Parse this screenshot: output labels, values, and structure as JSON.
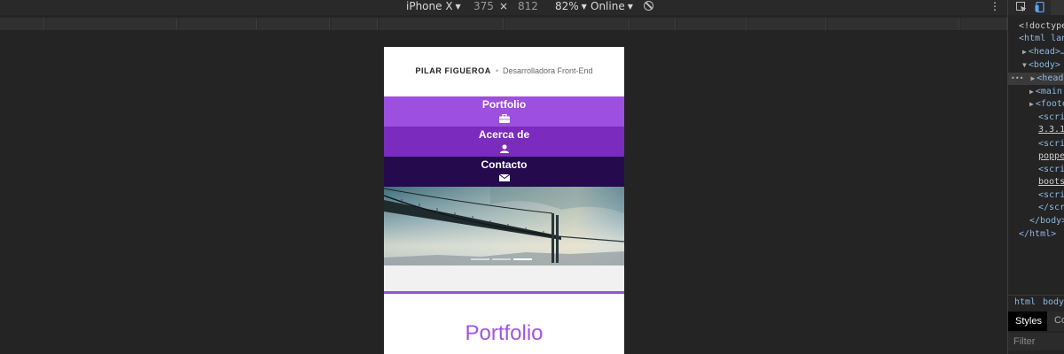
{
  "device_toolbar": {
    "device": "iPhone X",
    "width": "375",
    "times": "×",
    "height": "812",
    "zoom": "82%",
    "network": "Online",
    "more": "⋮"
  },
  "site": {
    "brand_name": "PILAR FIGUEROA",
    "separator": "•",
    "tagline": "Desarrolladora Front-End",
    "nav": [
      {
        "label": "Portfolio",
        "icon": "briefcase-icon"
      },
      {
        "label": "Acerca de",
        "icon": "user-icon"
      },
      {
        "label": "Contacto",
        "icon": "envelope-icon"
      }
    ],
    "carousel": {
      "slides": 3,
      "active": 3
    },
    "section_title": "Portfolio"
  },
  "devtools": {
    "dom_lines": [
      "<!doctype",
      "<html lan",
      "<head>…",
      "<body>",
      "<heade",
      "<main",
      "<foote",
      "<scri",
      "3.3.1",
      "<scri",
      "poppe",
      "<scri",
      "boots",
      "<scri",
      "</scr",
      "</body>",
      "</html>"
    ],
    "ellipsis": "•••",
    "breadcrumbs": [
      "html",
      "body"
    ],
    "styles_tab": "Styles",
    "computed_tab": "Co",
    "filter_placeholder": "Filter"
  },
  "colors": {
    "nav_portfolio": "#9d4fdf",
    "nav_about": "#7b2bbe",
    "nav_contact": "#250a4e",
    "accent": "#a355dd"
  }
}
